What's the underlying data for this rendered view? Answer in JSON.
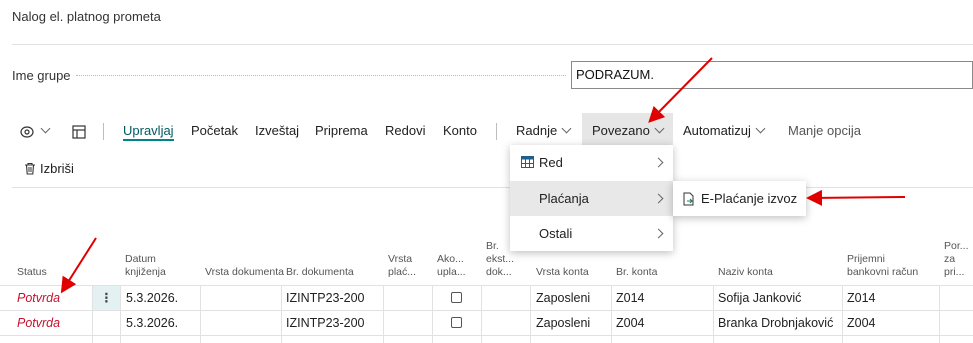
{
  "page": {
    "title": "Nalog el. platnog prometa"
  },
  "header": {
    "group_label": "Ime grupe",
    "group_value": "PODRAZUM."
  },
  "toolbar": {
    "upravljaj": "Upravljaj",
    "pocetak": "Početak",
    "izvestaj": "Izveštaj",
    "priprema": "Priprema",
    "redovi": "Redovi",
    "konto": "Konto",
    "radnje": "Radnje",
    "povezano": "Povezano",
    "automatizuj": "Automatizuj",
    "manje_opcija": "Manje opcija"
  },
  "actions": {
    "delete": "Izbriši"
  },
  "menu": {
    "items": [
      {
        "label": "Red",
        "icon": "table-icon"
      },
      {
        "label": "Plaćanja"
      },
      {
        "label": "Ostali"
      }
    ]
  },
  "submenu": {
    "item": "E-Plaćanje izvoz"
  },
  "columns": {
    "status": "Status",
    "datum_1": "Datum",
    "datum_2": "knjiženja",
    "vrsta_dok": "Vrsta dokumenta",
    "br_dok": "Br. dokumenta",
    "vrsta_plac_1": "Vrsta",
    "vrsta_plac_2": "plać...",
    "ako_1": "Ako...",
    "ako_2": "upla...",
    "br_ekst_1": "Br.",
    "br_ekst_2": "ekst...",
    "br_ekst_3": "dok...",
    "vrsta_konta": "Vrsta konta",
    "br_konta": "Br. konta",
    "naziv_konta": "Naziv konta",
    "prijemni_1": "Prijemni",
    "prijemni_2": "bankovni račun",
    "por_1": "Por...",
    "por_2": "za",
    "por_3": "pri..."
  },
  "rows": [
    {
      "status": "Potvrda",
      "datum": "5.3.2026.",
      "br_dok": "IZINTP23-200",
      "vrsta_konta": "Zaposleni",
      "br_konta": "Z014",
      "naziv_konta": "Sofija Janković",
      "prijemni": "Z014"
    },
    {
      "status": "Potvrda",
      "datum": "5.3.2026.",
      "br_dok": "IZINTP23-200",
      "vrsta_konta": "Zaposleni",
      "br_konta": "Z004",
      "naziv_konta": "Branka Drobnjaković",
      "prijemni": "Z004"
    }
  ],
  "colors": {
    "accent": "#008489",
    "status_link": "#c8102e",
    "annotation_arrow": "#e00000"
  }
}
